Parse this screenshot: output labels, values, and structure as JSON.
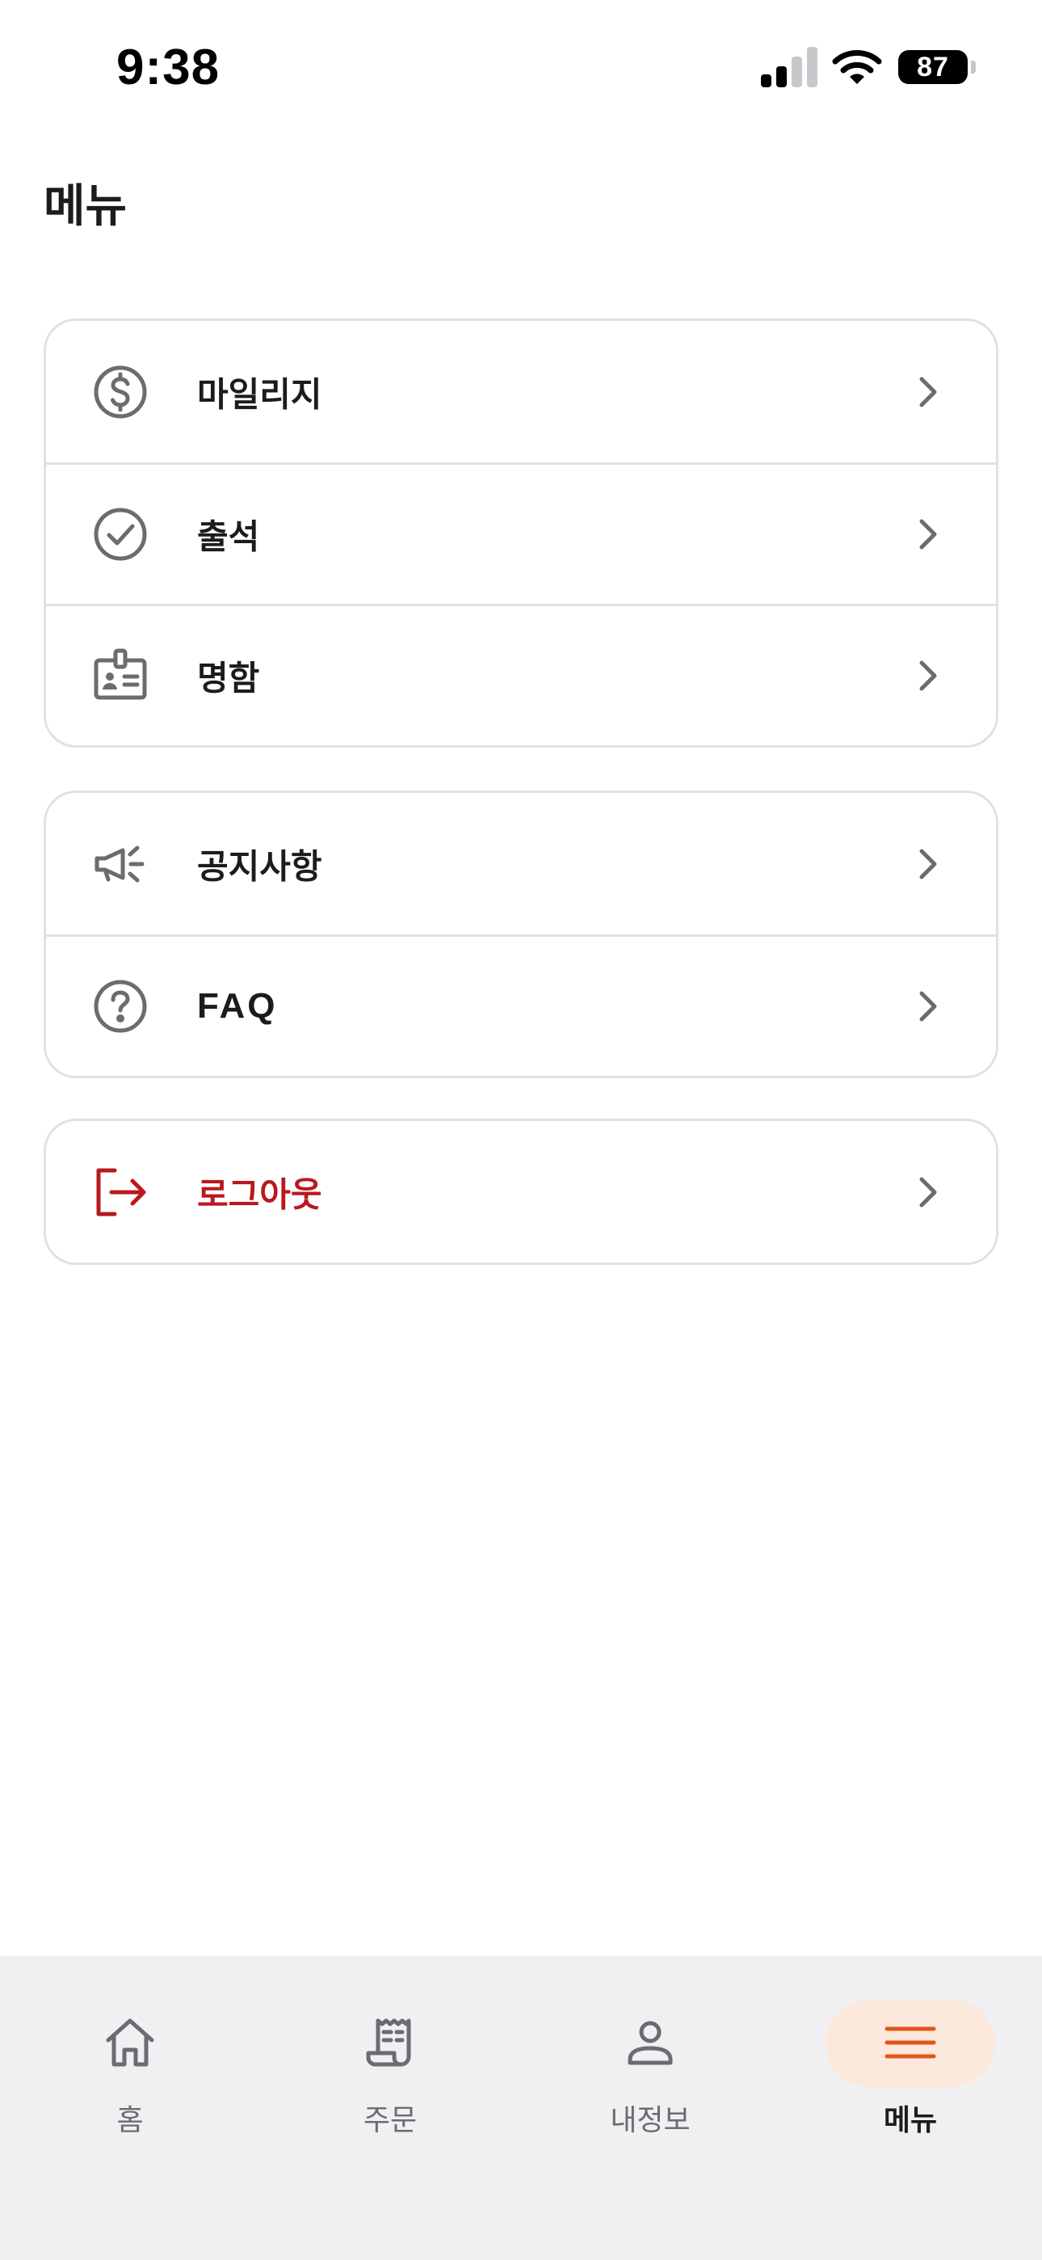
{
  "status_bar": {
    "time": "9:38",
    "battery": "87",
    "icons": [
      "cellular-signal-icon",
      "wifi-icon",
      "battery-icon"
    ]
  },
  "page": {
    "title": "메뉴"
  },
  "sections": [
    {
      "items": [
        {
          "label": "마일리지",
          "icon": "dollar-circle-icon"
        },
        {
          "label": "출석",
          "icon": "check-circle-icon"
        },
        {
          "label": "명함",
          "icon": "id-badge-icon"
        }
      ]
    },
    {
      "items": [
        {
          "label": "공지사항",
          "icon": "megaphone-icon"
        },
        {
          "label": "FAQ",
          "icon": "question-circle-icon"
        }
      ]
    },
    {
      "items": [
        {
          "label": "로그아웃",
          "icon": "logout-icon"
        }
      ]
    }
  ],
  "tab_bar": {
    "tabs": [
      {
        "label": "홈",
        "icon": "home-icon",
        "active": false
      },
      {
        "label": "주문",
        "icon": "receipt-icon",
        "active": false
      },
      {
        "label": "내정보",
        "icon": "person-icon",
        "active": false
      },
      {
        "label": "메뉴",
        "icon": "hamburger-menu-icon",
        "active": true
      }
    ]
  },
  "colors": {
    "text_primary": "#1c1c1e",
    "icon_gray": "#6b6b70",
    "danger_red": "#b8191d",
    "accent_orange": "#e0581c",
    "active_tab_bg": "#fde9dc",
    "tab_bar_bg": "#f0f0f3",
    "card_border": "#e1e1e4"
  }
}
